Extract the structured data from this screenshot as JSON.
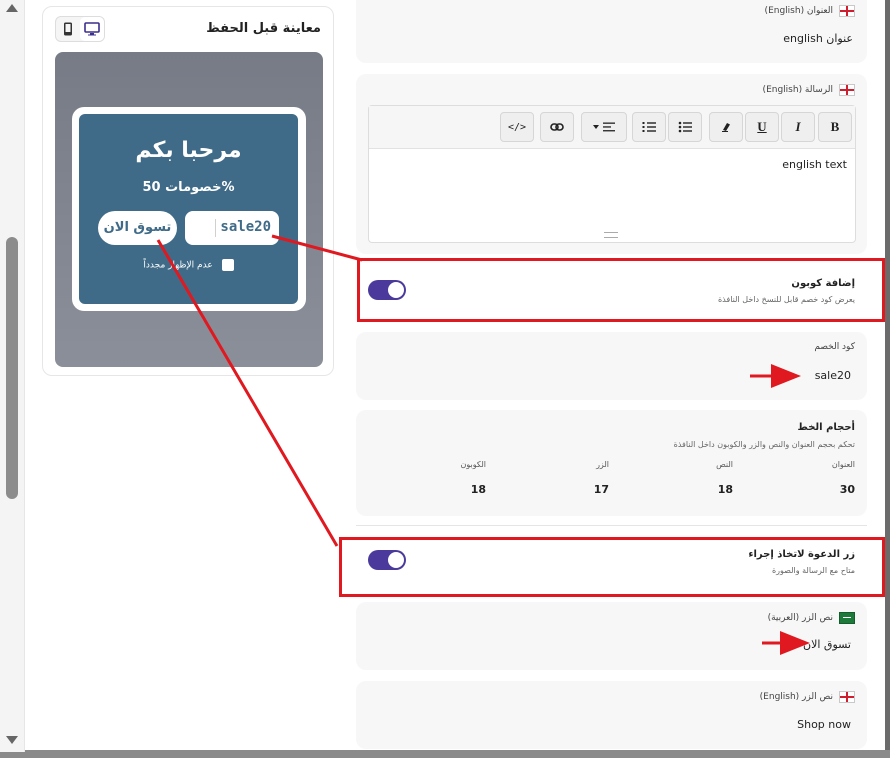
{
  "preview": {
    "title": "معاينة قبل الحفظ",
    "popup": {
      "title": "مرحبا بكم",
      "message": "خصومات 50%",
      "coupon_code": "sale20",
      "cta_label": "تسوق الان",
      "dont_show_label": "عدم الإظهار مجدداً",
      "bg_color": "#3f6b88"
    }
  },
  "form": {
    "title_en": {
      "label": "العنوان (English)",
      "value": "عنوان english"
    },
    "message_en": {
      "label": "الرسالة (English)",
      "value": "english text",
      "toolbar": [
        "B",
        "I",
        "U",
        "¶",
        "•≡",
        "1≡",
        "≡▾",
        "🔗",
        "</>"
      ]
    },
    "add_coupon": {
      "title": "إضافة كوبون",
      "subtitle": "يعرض كود خصم قابل للنسخ داخل النافذة",
      "enabled": true
    },
    "coupon_code": {
      "label": "كود الخصم",
      "value": "sale20"
    },
    "font_sizes": {
      "title": "أحجام الخط",
      "subtitle": "تحكم بحجم العنوان والنص والزر والكوبون داخل النافذة",
      "columns": [
        {
          "label": "العنوان",
          "value": "30"
        },
        {
          "label": "النص",
          "value": "18"
        },
        {
          "label": "الزر",
          "value": "17"
        },
        {
          "label": "الكوبون",
          "value": "18"
        }
      ]
    },
    "cta": {
      "title": "زر الدعوة لاتخاذ إجراء",
      "subtitle": "متاح مع الرسالة والصورة",
      "enabled": true
    },
    "button_text_ar": {
      "label": "نص الزر (العربية)",
      "value": "تسوق الان"
    },
    "button_text_en": {
      "label": "نص الزر (English)",
      "value": "Shop now"
    }
  },
  "colors": {
    "toggle": "#4b3a9c",
    "annotation": "#e0181f"
  }
}
